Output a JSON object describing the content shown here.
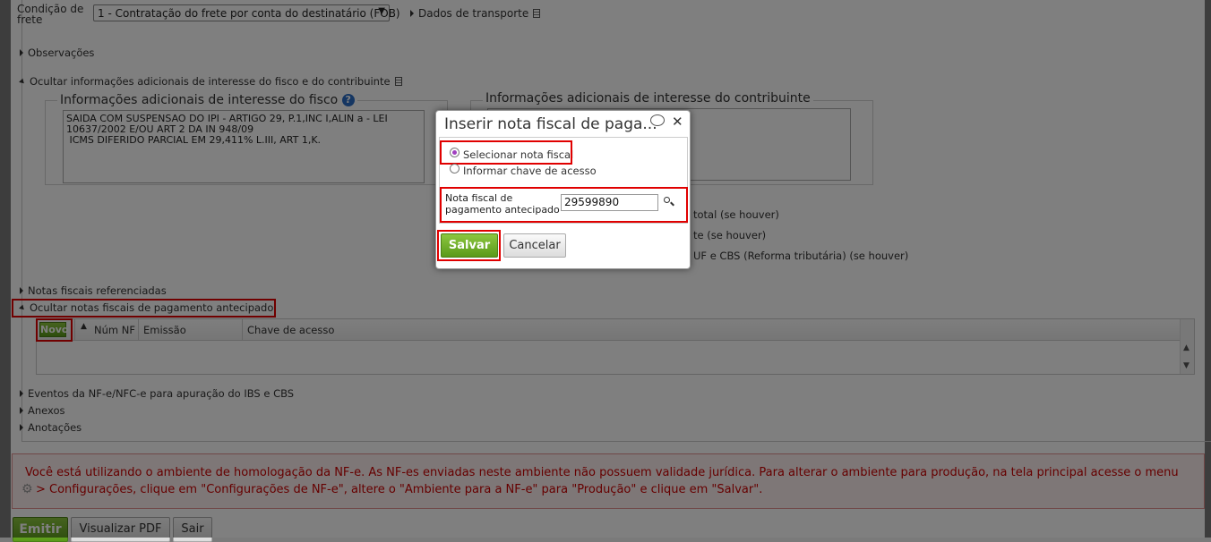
{
  "form": {
    "freight_condition_label_1": "Condição de",
    "freight_condition_label_2": "frete",
    "freight_condition_value": "1 - Contratação do frete por conta do destinatário (FOB)",
    "transport_data": "Dados de transporte",
    "observations": "Observações",
    "hide_additional_info": "Ocultar informações adicionais de interesse do fisco e do contribuinte",
    "fisco_legend": "Informações adicionais de interesse do fisco",
    "fisco_text": "SAIDA COM SUSPENSAO DO IPI - ARTIGO 29, P.1,INC I,ALIN a - LEI 10637/2002 E/OU ART 2 DA IN 948/09\n ICMS DIFERIDO PARCIAL EM 29,411% L.III, ART 1,K.",
    "contrib_legend": "Informações adicionais de interesse do contribuinte",
    "partial_line_1": "total (se houver)",
    "partial_line_2": "te (se houver)",
    "partial_line_3": "UF e CBS (Reforma tributária) (se houver)",
    "referenced_invoices": "Notas fiscais referenciadas",
    "hide_prepaid_invoices": "Ocultar notas fiscais de pagamento antecipado",
    "events": "Eventos da NF-e/NFC-e para apuração do IBS e CBS",
    "attachments": "Anexos",
    "notes": "Anotações"
  },
  "grid": {
    "new_button": "Novo",
    "columns": [
      "Núm NF",
      "Emissão",
      "Chave de acesso"
    ]
  },
  "warning": {
    "line1": "Você está utilizando o ambiente de homologação da NF-e. As NF-es enviadas neste ambiente não possuem validade jurídica. Para alterar o ambiente para produção, na tela principal acesse o menu",
    "line2": "> Configurações, clique em \"Configurações de NF-e\", altere o \"Ambiente para a NF-e\" para \"Produção\" e clique em \"Salvar\"."
  },
  "footer": {
    "emit": "Emitir",
    "preview_pdf": "Visualizar PDF",
    "exit": "Sair"
  },
  "dialog": {
    "title": "Inserir nota fiscal de paga...",
    "option_select": "Selecionar nota fiscal",
    "option_key": "Informar chave de acesso",
    "field_label_1": "Nota fiscal de",
    "field_label_2": "pagamento antecipado",
    "field_value": "29599890",
    "save": "Salvar",
    "cancel": "Cancelar"
  },
  "colors": {
    "accent_green": "#6aaa22",
    "highlight_red": "#e00000",
    "warning_text": "#cc0000",
    "warning_bg": "#fdeeee"
  },
  "icons": [
    "doc-icon",
    "help-icon",
    "comment-icon",
    "close-icon",
    "search-icon",
    "gear-icon",
    "sort-up-icon",
    "scroll-up-icon",
    "scroll-down-icon",
    "radio-icon"
  ]
}
